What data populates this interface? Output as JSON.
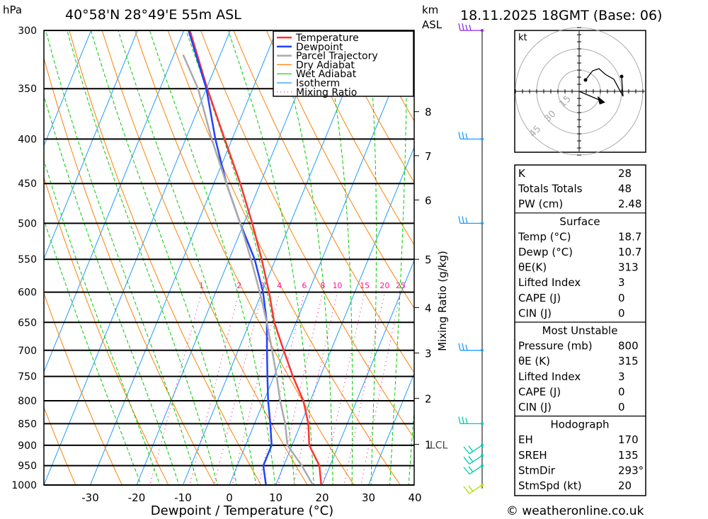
{
  "header": {
    "pressure_unit": "hPa",
    "location": "40°58'N  28°49'E  55m  ASL",
    "height_unit_top": "km",
    "height_unit_bottom": "ASL",
    "datetime": "18.11.2025  18GMT  (Base: 06)"
  },
  "chart_data": {
    "type": "line",
    "subtype": "skew-t log-p",
    "xlabel": "Dewpoint / Temperature (°C)",
    "ylabel": "hPa",
    "xlim": [
      -40,
      40
    ],
    "ylim": [
      1000,
      300
    ],
    "y_scale": "log",
    "x_ticks": [
      "-30",
      "-20",
      "-10",
      "0",
      "10",
      "20",
      "30",
      "40"
    ],
    "y_ticks": [
      "300",
      "350",
      "400",
      "450",
      "500",
      "550",
      "600",
      "650",
      "700",
      "750",
      "800",
      "850",
      "900",
      "950",
      "1000"
    ],
    "km_ticks": [
      {
        "label": "8",
        "p": 372
      },
      {
        "label": "7",
        "p": 418
      },
      {
        "label": "6",
        "p": 470
      },
      {
        "label": "5",
        "p": 550
      },
      {
        "label": "4",
        "p": 625
      },
      {
        "label": "3",
        "p": 705
      },
      {
        "label": "2",
        "p": 795
      },
      {
        "label": "1",
        "p": 898
      }
    ],
    "lcl_label": "LCL",
    "lcl_pressure": 898,
    "mixing_ratio_label": "Mixing Ratio (g/kg)",
    "mixing_ratio_values": [
      "1",
      "2",
      "3",
      "4",
      "6",
      "8",
      "10",
      "15",
      "20",
      "25"
    ],
    "legend": [
      {
        "name": "Temperature",
        "color": "#ff3333",
        "style": "solid"
      },
      {
        "name": "Dewpoint",
        "color": "#2244ff",
        "style": "solid"
      },
      {
        "name": "Parcel Trajectory",
        "color": "#aaaaaa",
        "style": "solid"
      },
      {
        "name": "Dry Adiabat",
        "color": "#ff8000",
        "style": "thin"
      },
      {
        "name": "Wet Adiabat",
        "color": "#00cc00",
        "style": "dashed"
      },
      {
        "name": "Isotherm",
        "color": "#1e9bff",
        "style": "thin"
      },
      {
        "name": "Mixing Ratio",
        "color": "#ff1493",
        "style": "dotted"
      }
    ],
    "legend_position": "top-right",
    "pressure": [
      1000,
      950,
      900,
      850,
      800,
      750,
      700,
      650,
      600,
      550,
      500,
      450,
      400,
      350,
      300
    ],
    "series": [
      {
        "name": "Temperature",
        "values": [
          19.8,
          17.7,
          13.7,
          11.6,
          8.5,
          4.1,
          -0.2,
          -4.7,
          -8.5,
          -13.0,
          -18.2,
          -24.3,
          -31.6,
          -39.8,
          -48.7
        ]
      },
      {
        "name": "Dewpoint",
        "values": [
          7.9,
          5.6,
          5.6,
          3.4,
          0.9,
          -1.4,
          -3.8,
          -6.3,
          -9.8,
          -14.5,
          -20.8,
          -27.3,
          -33.6,
          -40.0,
          -49.0
        ]
      },
      {
        "name": "Parcel Trajectory",
        "values": [
          18.0,
          13.9,
          9.0,
          6.6,
          3.5,
          0.6,
          -2.7,
          -6.3,
          -10.5,
          -15.3,
          -20.8,
          -27.3,
          -34.4,
          -41.8,
          null
        ]
      }
    ],
    "surface": {
      "pressure": 1010,
      "temperature": 18.7,
      "dewpoint": 10.7
    },
    "wind_barb_levels": [
      300,
      400,
      500,
      700,
      850,
      900,
      925,
      950,
      1000
    ]
  },
  "hodograph": {
    "unit": "kt",
    "rings": [
      "15",
      "30",
      "45"
    ],
    "path_uv": [
      [
        4.5,
        8
      ],
      [
        9.5,
        14.5
      ],
      [
        14,
        16
      ],
      [
        18.5,
        12
      ],
      [
        24.5,
        8.5
      ],
      [
        31,
        -3.5
      ],
      [
        30,
        10.5
      ]
    ],
    "storm_motion_uv": [
      18.4,
      -7.8
    ]
  },
  "indices": {
    "top": [
      {
        "label": "K",
        "value": "28"
      },
      {
        "label": "Totals Totals",
        "value": "48"
      },
      {
        "label": "PW (cm)",
        "value": "2.48"
      }
    ],
    "sections": [
      {
        "title": "Surface",
        "rows": [
          {
            "label": "Temp (°C)",
            "value": "18.7"
          },
          {
            "label": "Dewp (°C)",
            "value": "10.7"
          },
          {
            "label": "θE(K)",
            "value": "313"
          },
          {
            "label": "Lifted Index",
            "value": "3"
          },
          {
            "label": "CAPE (J)",
            "value": "0"
          },
          {
            "label": "CIN (J)",
            "value": "0"
          }
        ]
      },
      {
        "title": "Most Unstable",
        "rows": [
          {
            "label": "Pressure (mb)",
            "value": "800"
          },
          {
            "label": "θE (K)",
            "value": "315"
          },
          {
            "label": "Lifted Index",
            "value": "3"
          },
          {
            "label": "CAPE (J)",
            "value": "0"
          },
          {
            "label": "CIN (J)",
            "value": "0"
          }
        ]
      },
      {
        "title": "Hodograph",
        "rows": [
          {
            "label": "EH",
            "value": "170"
          },
          {
            "label": "SREH",
            "value": "135"
          },
          {
            "label": "StmDir",
            "value": "293°"
          },
          {
            "label": "StmSpd (kt)",
            "value": "20"
          }
        ]
      }
    ]
  },
  "footer": {
    "copyright": "© weatheronline.co.uk"
  }
}
